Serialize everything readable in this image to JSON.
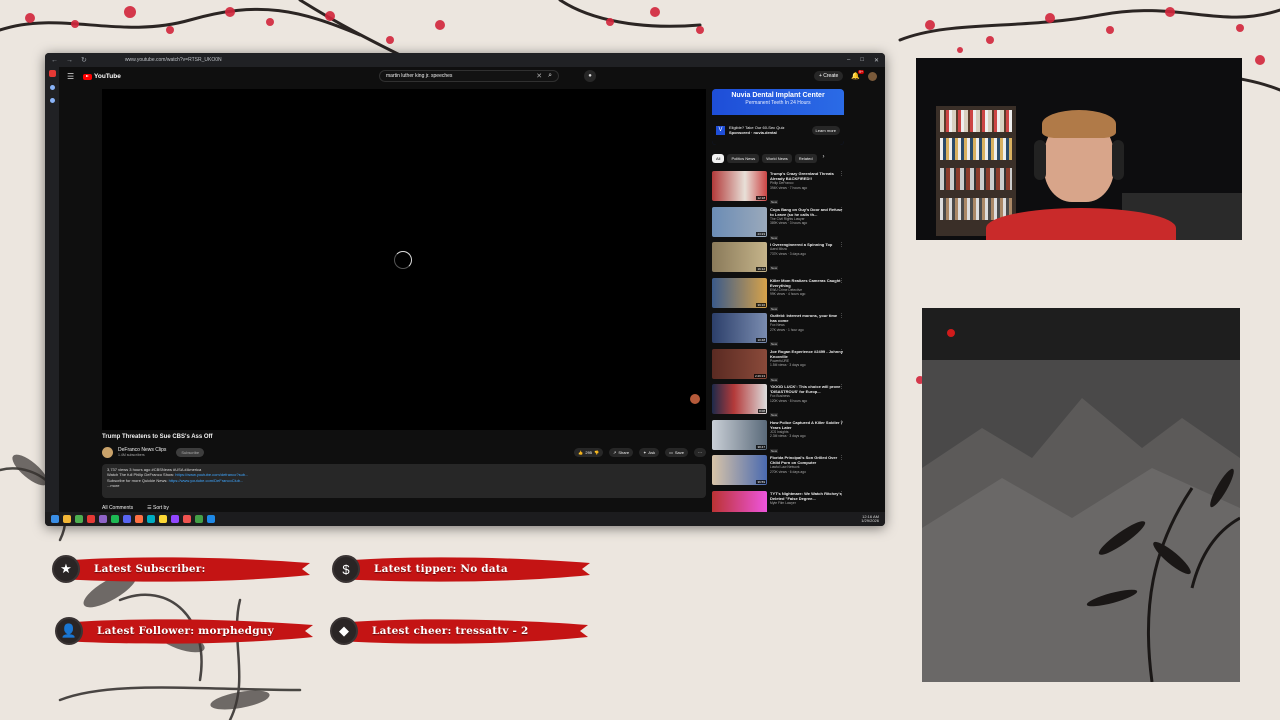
{
  "browser": {
    "url": "www.youtube.com/watch?v=RTSR_UKO0N",
    "search_query": "martin luther king jr. speeches",
    "create_label": "Create",
    "notification_count": "9+"
  },
  "youtube": {
    "logo_text": "YouTube",
    "video": {
      "title": "Trump Threatens to Sue CBS's Ass Off",
      "channel": "DeFranco News Clips",
      "subscribers": "1.4M subscribers",
      "subscribe_label": "Subscribe",
      "likes": "295",
      "share_label": "Share",
      "ask_label": "Ask",
      "save_label": "Save",
      "description_line1": "3,737 views 3 hours ago #CBSNews #USA #America",
      "description_line2": "Watch The full Philip DeFranco Show:",
      "description_link1": "https://www.youtube.com/defranco?sub...",
      "description_line3": "Subscribe for more Quickie News:",
      "description_link2": "https://www.youtube.com/DeFrancoClub...",
      "more_label": "...more",
      "comments_label": "All Comments",
      "sort_label": "Sort by"
    },
    "ad": {
      "headline": "Nuvia Dental Implant Center",
      "subline": "Permanent Teeth In 24 Hours",
      "body": "Eligible? Take Our 60-Sec Quiz",
      "sponsored": "Sponsored",
      "domain": "nuvia.dental",
      "learn_more": "Learn more"
    },
    "chips": [
      "All",
      "Politics News",
      "World News",
      "Related"
    ],
    "recommendations": [
      {
        "title": "Trump's Crazy Greenland Threats Already BACKFIRED!!",
        "channel": "Philip DeFranco",
        "meta": "394K views · 7 hours ago",
        "badge": "New",
        "duration": "12:18"
      },
      {
        "title": "Cops Bang on Guy's Door and Refuse to Leave (so he calls th...",
        "channel": "The Civil Rights Lawyer",
        "meta": "389K views · 3 hours ago",
        "badge": "New",
        "duration": "23:23"
      },
      {
        "title": "I Overengineered a Spinning Top",
        "channel": "Aaed Mirza",
        "meta": "737K views · 3 days ago",
        "badge": "New",
        "duration": "16:12"
      },
      {
        "title": "Killer Mom Realizes Cameras Caught Everything",
        "channel": "EWU Crime Detective",
        "meta": "99K views · 4 hours ago",
        "badge": "New",
        "duration": "39:16"
      },
      {
        "title": "Gutfeld: Internet morons, your time has come",
        "channel": "Fox News",
        "meta": "27K views · 1 hour ago",
        "badge": "New",
        "duration": "10:48"
      },
      {
        "title": "Joe Rogan Experience #2499 - Johnny Knoxville",
        "channel": "PowerfulJRE",
        "meta": "1.5M views · 3 days ago",
        "badge": "New",
        "duration": "2:29:13"
      },
      {
        "title": "'GOOD LUCK': This choice will prove 'DISASTROUS' for Europ...",
        "channel": "Fox Business",
        "meta": "120K views · 8 hours ago",
        "badge": "New",
        "duration": "8:08"
      },
      {
        "title": "How Police Captured A Killer Soldier 7 Years Later",
        "channel": "JCS Insights",
        "meta": "2.3M views · 3 days ago",
        "badge": "New",
        "duration": "38:47"
      },
      {
        "title": "Florida Principal's Son Grilled Over Child Porn on Computer",
        "channel": "Lawful Law Network",
        "meta": "270K views · 6 days ago",
        "badge": "",
        "duration": "36:59"
      },
      {
        "title": "TYT's Nightmare: We Watch Ritchey's Deleted \"False Degree...",
        "channel": "Myte Film Lawyer",
        "meta": "",
        "badge": "",
        "duration": ""
      }
    ]
  },
  "taskbar": {
    "time": "12:16 AM",
    "date": "1/29/2026"
  },
  "alerts": {
    "subscriber": "Latest Subscriber:",
    "tipper": "Latest tipper: No data",
    "follower": "Latest Follower: morphedguy",
    "cheer": "Latest cheer: tressattv - 2"
  },
  "colors": {
    "youtube_red": "#ff0000",
    "brush_red": "#c41414",
    "ad_blue": "#1e4ed8"
  }
}
